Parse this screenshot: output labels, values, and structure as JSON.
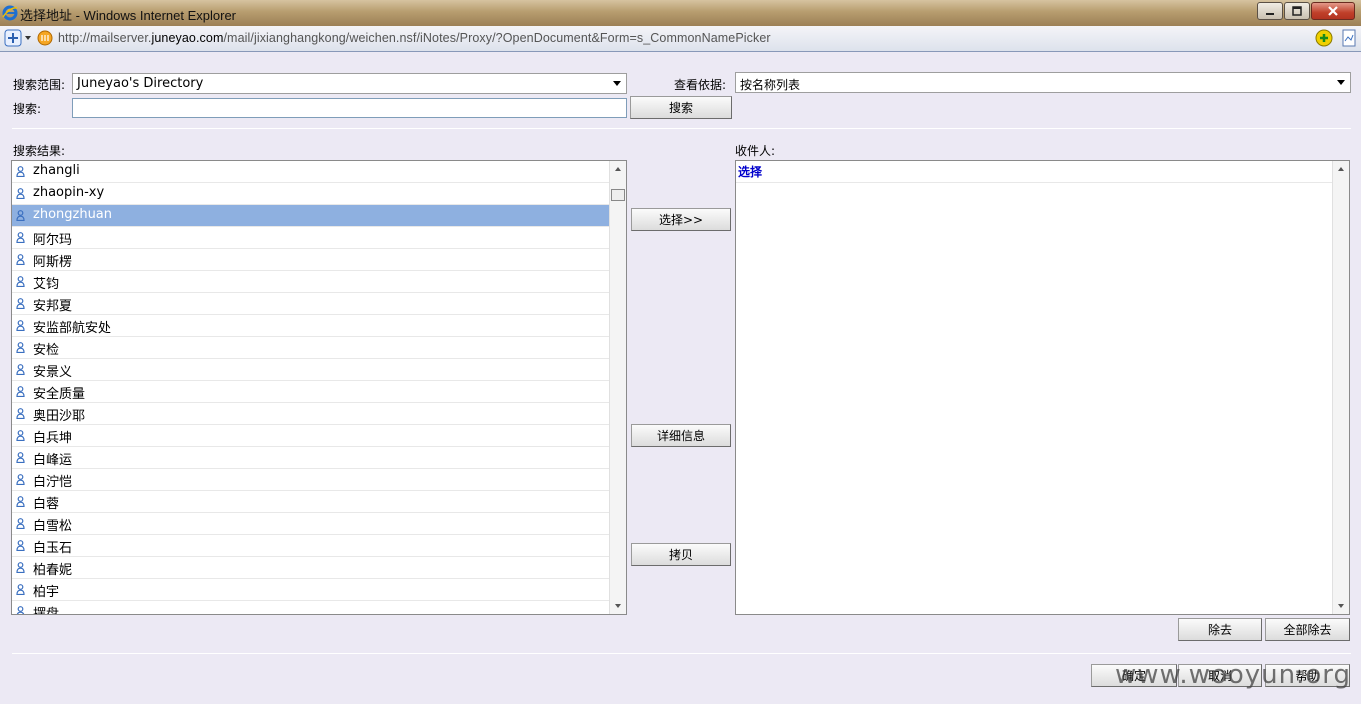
{
  "window": {
    "title": "选择地址 - Windows Internet Explorer",
    "url_prefix": "http://mailserver.",
    "url_domain": "juneyao.com",
    "url_path": "/mail/jixianghangkong/weichen.nsf/iNotes/Proxy/?OpenDocument&Form=s_CommonNamePicker"
  },
  "search": {
    "scope_label": "搜索范围:",
    "scope_value": "Juneyao's Directory",
    "view_label": "查看依据:",
    "view_value": "按名称列表",
    "search_label": "搜索:",
    "search_value": "",
    "search_button": "搜索"
  },
  "results": {
    "label": "搜索结果:",
    "items": [
      {
        "name": "zhangli"
      },
      {
        "name": "zhaopin-xy"
      },
      {
        "name": "zhongzhuan"
      },
      {
        "name": "阿尔玛"
      },
      {
        "name": "阿斯楞"
      },
      {
        "name": "艾钧"
      },
      {
        "name": "安邦夏"
      },
      {
        "name": "安监部航安处"
      },
      {
        "name": "安检"
      },
      {
        "name": "安景义"
      },
      {
        "name": "安全质量"
      },
      {
        "name": "奥田沙耶"
      },
      {
        "name": "白兵坤"
      },
      {
        "name": "白峰运"
      },
      {
        "name": "白泞恺"
      },
      {
        "name": "白蓉"
      },
      {
        "name": "白雪松"
      },
      {
        "name": "白玉石"
      },
      {
        "name": "柏春妮"
      },
      {
        "name": "柏宇"
      },
      {
        "name": "摆盘"
      }
    ],
    "selected_index": 2
  },
  "actions": {
    "select": "选择>>",
    "details": "详细信息",
    "copy": "拷贝"
  },
  "recipients": {
    "label": "收件人:",
    "header": "选择",
    "remove": "除去",
    "remove_all": "全部除去"
  },
  "footer": {
    "ok": "确定",
    "cancel": "取消",
    "help": "帮助"
  },
  "watermark": "www.wooyun.org",
  "colors": {
    "selected_row": "#8eb0e0",
    "recipient_header": "#0000cc",
    "dialog_bg": "#ece9f4"
  }
}
